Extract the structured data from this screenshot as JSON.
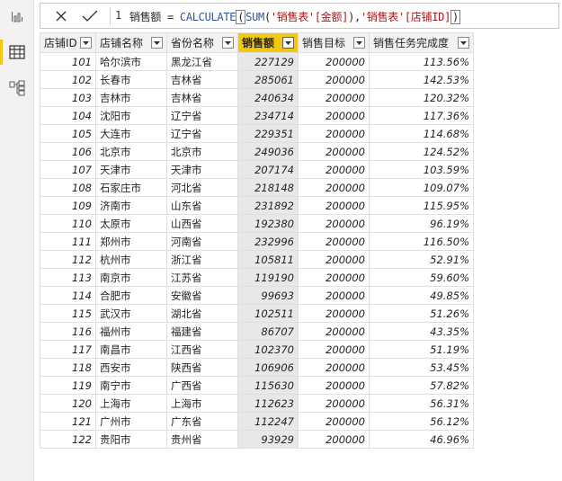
{
  "toolbar": {
    "cancel_label": "×",
    "confirm_label": "✓"
  },
  "formula": {
    "line_number": "1",
    "measure": "销售额",
    "equals": " = ",
    "func1": "CALCULATE",
    "open1": "(",
    "func2": "SUM",
    "open2": "(",
    "arg1": "'销售表'[金额]",
    "close2": ")",
    "comma": ",",
    "arg2": "'销售表'[店铺ID]",
    "close1": ")"
  },
  "table": {
    "columns": [
      "店铺ID",
      "店铺名称",
      "省份名称",
      "销售额",
      "销售目标",
      "销售任务完成度"
    ],
    "selected_column": "销售额",
    "rows": [
      [
        "101",
        "哈尔滨市",
        "黑龙江省",
        "227129",
        "200000",
        "113.56%"
      ],
      [
        "102",
        "长春市",
        "吉林省",
        "285061",
        "200000",
        "142.53%"
      ],
      [
        "103",
        "吉林市",
        "吉林省",
        "240634",
        "200000",
        "120.32%"
      ],
      [
        "104",
        "沈阳市",
        "辽宁省",
        "234714",
        "200000",
        "117.36%"
      ],
      [
        "105",
        "大连市",
        "辽宁省",
        "229351",
        "200000",
        "114.68%"
      ],
      [
        "106",
        "北京市",
        "北京市",
        "249036",
        "200000",
        "124.52%"
      ],
      [
        "107",
        "天津市",
        "天津市",
        "207174",
        "200000",
        "103.59%"
      ],
      [
        "108",
        "石家庄市",
        "河北省",
        "218148",
        "200000",
        "109.07%"
      ],
      [
        "109",
        "济南市",
        "山东省",
        "231892",
        "200000",
        "115.95%"
      ],
      [
        "110",
        "太原市",
        "山西省",
        "192380",
        "200000",
        "96.19%"
      ],
      [
        "111",
        "郑州市",
        "河南省",
        "232996",
        "200000",
        "116.50%"
      ],
      [
        "112",
        "杭州市",
        "浙江省",
        "105811",
        "200000",
        "52.91%"
      ],
      [
        "113",
        "南京市",
        "江苏省",
        "119190",
        "200000",
        "59.60%"
      ],
      [
        "114",
        "合肥市",
        "安徽省",
        "99693",
        "200000",
        "49.85%"
      ],
      [
        "115",
        "武汉市",
        "湖北省",
        "102511",
        "200000",
        "51.26%"
      ],
      [
        "116",
        "福州市",
        "福建省",
        "86707",
        "200000",
        "43.35%"
      ],
      [
        "117",
        "南昌市",
        "江西省",
        "102370",
        "200000",
        "51.19%"
      ],
      [
        "118",
        "西安市",
        "陕西省",
        "106906",
        "200000",
        "53.45%"
      ],
      [
        "119",
        "南宁市",
        "广西省",
        "115630",
        "200000",
        "57.82%"
      ],
      [
        "120",
        "上海市",
        "上海市",
        "112623",
        "200000",
        "56.31%"
      ],
      [
        "121",
        "广州市",
        "广东省",
        "112247",
        "200000",
        "56.12%"
      ],
      [
        "122",
        "贵阳市",
        "贵州省",
        "93929",
        "200000",
        "46.96%"
      ]
    ]
  },
  "colors": {
    "accent_yellow": "#f2c811",
    "dax_function": "#2f5597",
    "dax_string": "#a31515",
    "header_bg": "#f3f2f1",
    "selected_column_bg": "#e8e8e8"
  },
  "icons": {
    "report_view": "bar-chart-icon",
    "data_view": "table-grid-icon",
    "model_view": "model-icon",
    "dropdown": "dropdown-arrow-icon"
  }
}
